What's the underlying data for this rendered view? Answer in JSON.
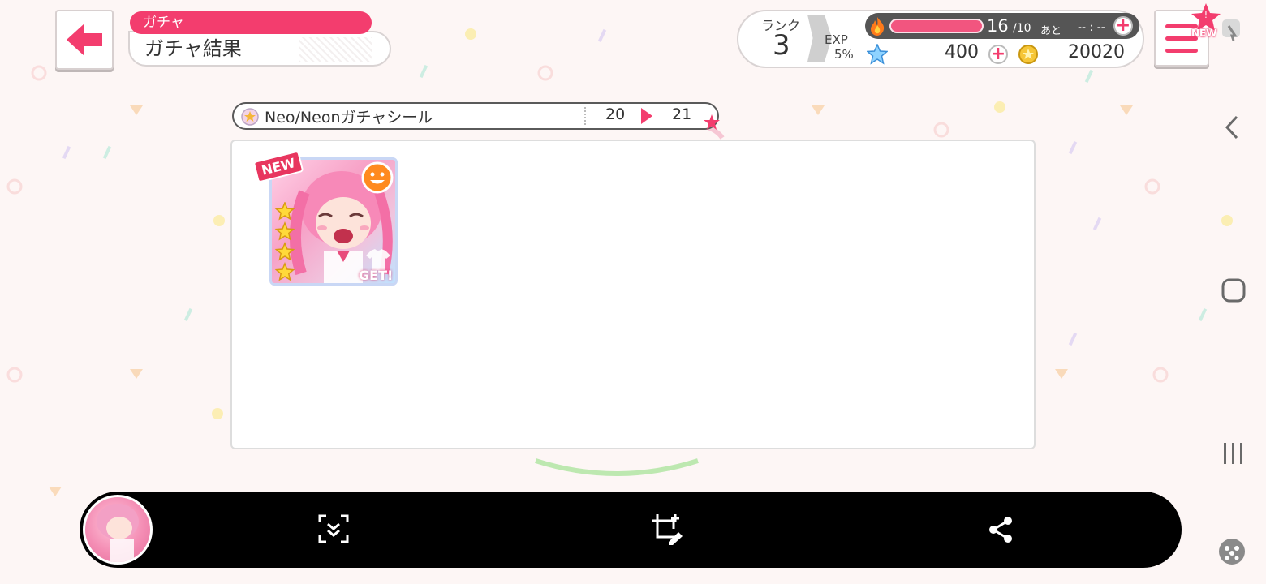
{
  "header": {
    "category": "ガチャ",
    "title": "ガチャ結果"
  },
  "status": {
    "rank_label": "ランク",
    "rank_value": "3",
    "exp_label": "EXP",
    "exp_value": "5%",
    "stamina_value": "16",
    "stamina_max": "/10",
    "stamina_suffix": "あと",
    "stamina_timer": "-- : --",
    "stamina_fill_fraction": 1.0,
    "star_value": "400",
    "coin_value": "20020"
  },
  "menu": {
    "badge": "NEW"
  },
  "sticker": {
    "name": "Neo/Neonガチャシール",
    "from": "20",
    "to": "21"
  },
  "result": {
    "card_new_label": "NEW",
    "card_get_label": "GET!",
    "card_stars": 4
  },
  "colors": {
    "accent": "#f33d6e",
    "stamina_fill": "#f2557f",
    "toolbar": "#000000"
  }
}
